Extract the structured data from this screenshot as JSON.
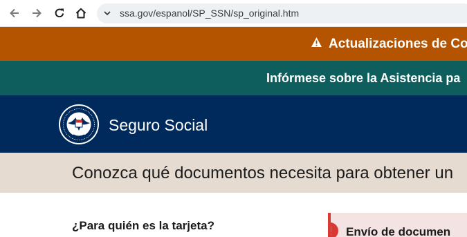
{
  "browser": {
    "url": "ssa.gov/espanol/SP_SSN/sp_original.htm",
    "icons": [
      "back-arrow-icon",
      "forward-arrow-icon",
      "reload-icon",
      "home-icon",
      "site-settings-icon"
    ]
  },
  "alerts": {
    "primary": {
      "text": "Actualizaciones de Co",
      "icon": "warning-icon",
      "color": "#b55400"
    },
    "secondary": {
      "text": "Infórmese sobre la Asistencia pa",
      "color": "#0f5e5e"
    }
  },
  "header": {
    "agency_name": "Seguro Social",
    "logo": "ssa-seal-logo",
    "color": "#002a5b"
  },
  "page": {
    "title": "Conozca qué documentos necesita para obtener un",
    "question": "¿Para quién es la tarjeta?",
    "notice": {
      "title": "Envío de documen",
      "icon": "error-icon",
      "accent": "#d83933"
    }
  }
}
